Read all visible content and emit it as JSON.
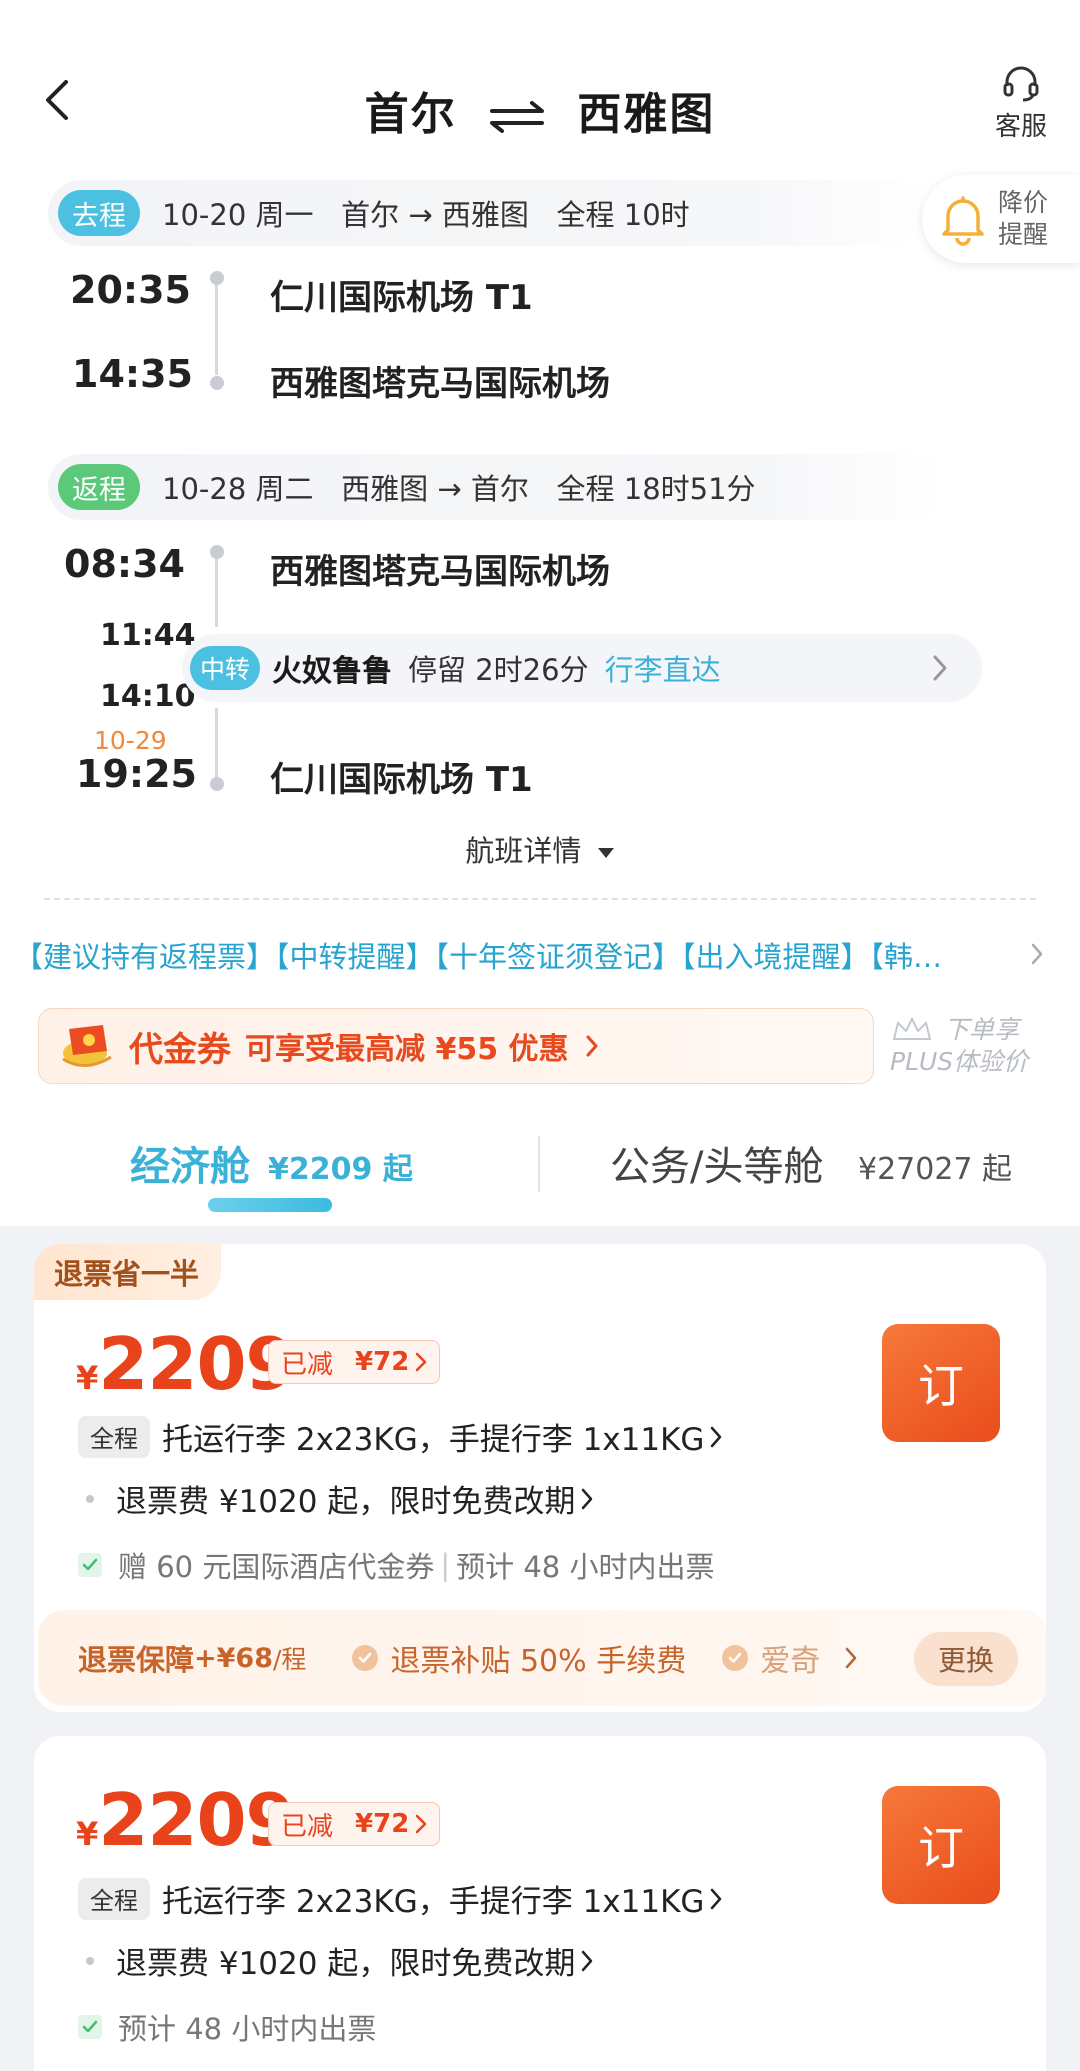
{
  "header": {
    "title_from": "首尔",
    "title_to": "西雅图",
    "customer_service": "客服"
  },
  "price_alert": {
    "line1": "降价",
    "line2": "提醒"
  },
  "outbound": {
    "badge": "去程",
    "summary": "10-20 周一   首尔 → 西雅图   全程 10时",
    "depart_time": "20:35",
    "depart_airport": "仁川国际机场 T1",
    "arrive_time": "14:35",
    "arrive_airport": "西雅图塔克马国际机场"
  },
  "return": {
    "badge": "返程",
    "summary": "10-28 周二   西雅图 → 首尔   全程 18时51分",
    "depart_time": "08:34",
    "depart_airport": "西雅图塔克马国际机场",
    "transfer_arrive": "11:44",
    "transfer_depart": "14:10",
    "transfer_badge": "中转",
    "transfer_city": "火奴鲁鲁",
    "transfer_stay": "停留 2时26分",
    "transfer_bag": "行李直达",
    "arrive_date": "10-29",
    "arrive_time": "19:25",
    "arrive_airport": "仁川国际机场 T1"
  },
  "flight_details": "航班详情",
  "tips": "【建议持有返程票】【中转提醒】【十年签证须登记】【出入境提醒】【韩…",
  "coupon": {
    "title": "代金券",
    "desc": "可享受最高减 ¥55 优惠",
    "plus_line1": "下单享",
    "plus_line2": "PLUS体验价"
  },
  "cabins": {
    "economy": "经济舱",
    "economy_price": "¥2209 起",
    "business": "公务/头等舱",
    "business_price": "¥27027 起"
  },
  "offers": [
    {
      "tag": "退票省一半",
      "currency": "¥",
      "price": "2209",
      "reduced_label": "已减",
      "reduced_amount": "¥72",
      "book": "订",
      "bag_badge": "全程",
      "bag_text": "托运行李 2x23KG，手提行李 1x11KG",
      "refund_text": "退票费 ¥1020 起，限时免费改期",
      "gift_text": "赠 60 元国际酒店代金券",
      "ticket_text": "预计 48 小时内出票",
      "guarantee": {
        "title": "退票保障",
        "price": "+¥68",
        "unit": "/程",
        "item1": "退票补贴 50% 手续费",
        "item2": "爱奇",
        "change": "更换"
      }
    },
    {
      "currency": "¥",
      "price": "2209",
      "reduced_label": "已减",
      "reduced_amount": "¥72",
      "book": "订",
      "bag_badge": "全程",
      "bag_text": "托运行李 2x23KG，手提行李 1x11KG",
      "refund_text": "退票费 ¥1020 起，限时免费改期",
      "ticket_text": "预计 48 小时内出票"
    }
  ],
  "colors": {
    "accent_blue": "#3ab2d8",
    "outbound_badge": "#4cc0e0",
    "return_badge": "#5cc97a",
    "price_red": "#e8431b",
    "date_orange": "#f08a3a"
  }
}
